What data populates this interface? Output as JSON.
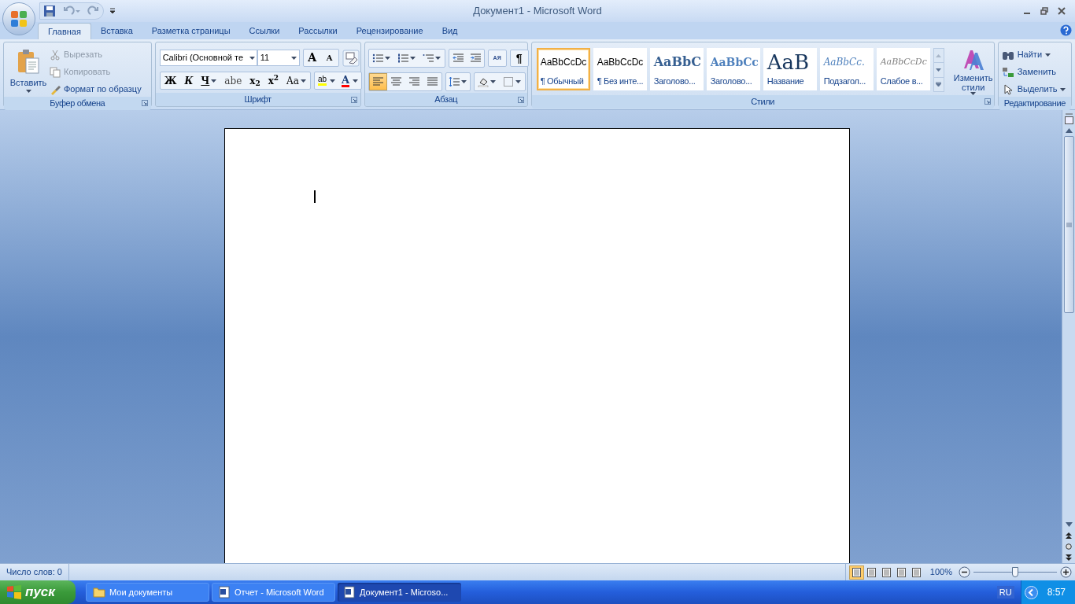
{
  "window": {
    "title": "Документ1 - Microsoft Word"
  },
  "tabs": [
    {
      "label": "Главная",
      "selected": true
    },
    {
      "label": "Вставка",
      "selected": false
    },
    {
      "label": "Разметка страницы",
      "selected": false
    },
    {
      "label": "Ссылки",
      "selected": false
    },
    {
      "label": "Рассылки",
      "selected": false
    },
    {
      "label": "Рецензирование",
      "selected": false
    },
    {
      "label": "Вид",
      "selected": false
    }
  ],
  "clipboard": {
    "title": "Буфер обмена",
    "paste_label": "Вставить",
    "items": [
      {
        "label": "Вырезать",
        "disabled": true
      },
      {
        "label": "Копировать",
        "disabled": true
      },
      {
        "label": "Формат по образцу",
        "disabled": false
      }
    ]
  },
  "font": {
    "title": "Шрифт",
    "font_name": "Calibri (Основной те",
    "font_size": "11",
    "grow_label": "A",
    "shrink_label": "A",
    "format_buttons": [
      {
        "label": "Ж",
        "kind": "bold"
      },
      {
        "label": "К",
        "kind": "italic"
      },
      {
        "label": "Ч",
        "kind": "underline"
      },
      {
        "label": "abe",
        "kind": "strike"
      },
      {
        "label": "x$_{2}$",
        "kind": "plain"
      },
      {
        "label": "x$^{2}$",
        "kind": "plain"
      },
      {
        "label": "Aa",
        "kind": "case"
      }
    ],
    "highlight_label": "ab",
    "color_label": "A"
  },
  "paragraph": {
    "title": "Абзац",
    "sort_label": "АЯ",
    "marks_label": "¶",
    "show_marks": false,
    "alignments": [
      {
        "selected": true
      },
      {
        "selected": false
      },
      {
        "selected": false
      },
      {
        "selected": false
      }
    ]
  },
  "styles": {
    "title": "Стили",
    "change_label": "Изменить стили",
    "items": [
      {
        "preview": "AaBbCcDc",
        "label": "¶ Обычный",
        "kind": "normal",
        "selected": true
      },
      {
        "preview": "AaBbCcDc",
        "label": "¶ Без инте...",
        "kind": "normal",
        "selected": false
      },
      {
        "preview": "AaBbC",
        "label": "Заголово...",
        "kind": "heading1",
        "selected": false
      },
      {
        "preview": "AaBbCc",
        "label": "Заголово...",
        "kind": "heading2",
        "selected": false
      },
      {
        "preview": "AaB",
        "label": "Название",
        "kind": "title",
        "selected": false
      },
      {
        "preview": "AaBbCc.",
        "label": "Подзагол...",
        "kind": "subtitle",
        "selected": false
      },
      {
        "preview": "AaBbCcDc",
        "label": "Слабое в...",
        "kind": "emphasis",
        "selected": false
      }
    ]
  },
  "editing": {
    "title": "Редактирование",
    "items": [
      {
        "label": "Найти",
        "kind": "find"
      },
      {
        "label": "Заменить",
        "kind": "replace"
      },
      {
        "label": "Выделить",
        "kind": "select"
      }
    ]
  },
  "status_bar": {
    "word_count": "Число слов: 0",
    "views": [
      {
        "selected": true
      },
      {
        "selected": false
      },
      {
        "selected": false
      },
      {
        "selected": false
      },
      {
        "selected": false
      }
    ],
    "zoom": "100%",
    "zoom_level": {
      "level": 0.5
    }
  },
  "taskbar": {
    "start_label": "пуск",
    "tasks": [
      {
        "label": "Мои документы",
        "kind": "folder",
        "selected": false
      },
      {
        "label": "Отчет - Microsoft Word",
        "kind": "word",
        "selected": false
      },
      {
        "label": "Документ1 - Microso...",
        "kind": "word",
        "selected": true
      }
    ],
    "language": "RU",
    "clock": "8:57"
  }
}
